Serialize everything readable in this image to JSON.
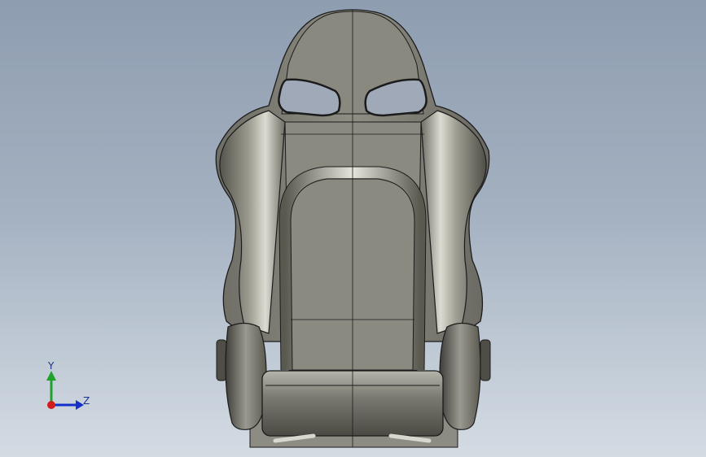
{
  "app": {
    "view": "graphics-area"
  },
  "model": {
    "name_icon": "racing-seat-model",
    "shading": "shaded-with-edges"
  },
  "triad": {
    "y_label": "Y",
    "z_label": "Z",
    "colors": {
      "y_axis": "#1fa12c",
      "z_axis": "#1530c8",
      "x_axis": "#d21c1c"
    }
  },
  "colors": {
    "seat_fill": "#8b8a80",
    "seat_dark": "#55544c",
    "seat_light": "#c9c8be",
    "edge": "#1b1b1b"
  }
}
